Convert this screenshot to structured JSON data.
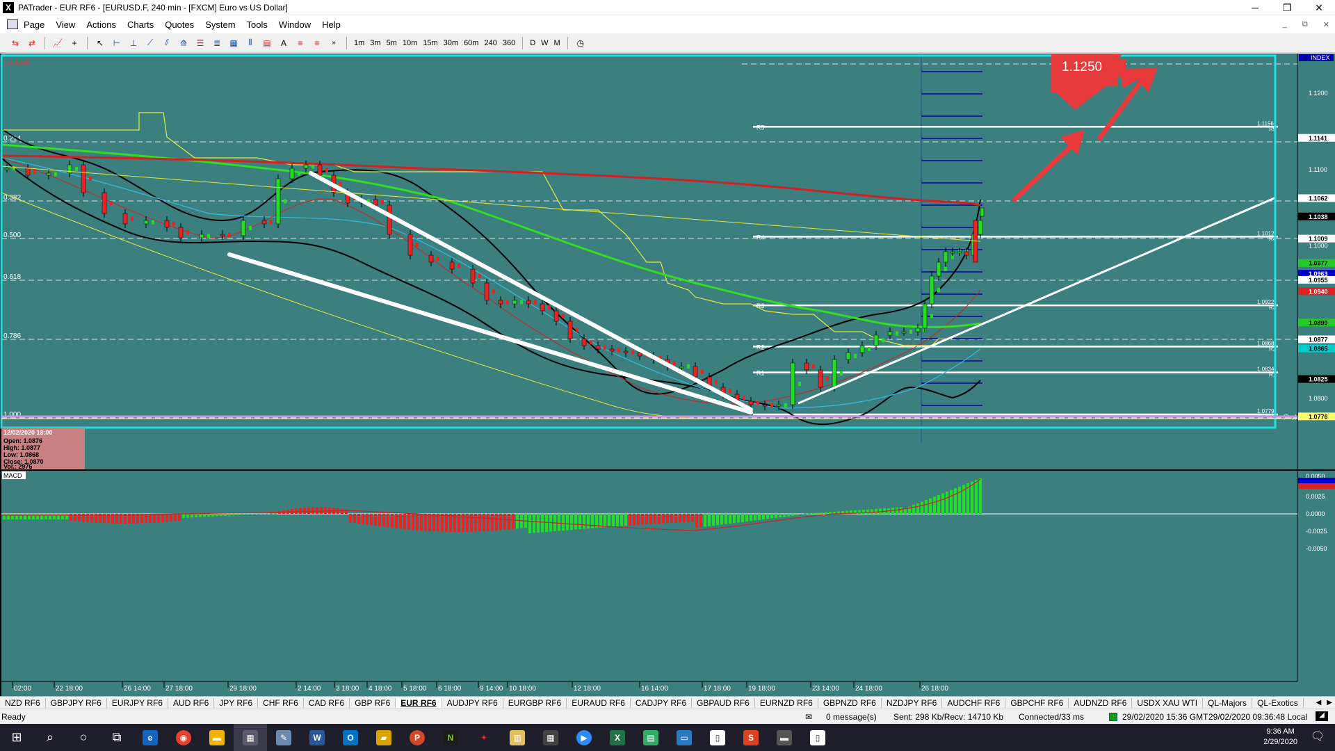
{
  "window": {
    "title": "PATrader - EUR RF6 - [EURUSD.F, 240 min - [FXCM] Euro vs US Dollar]",
    "app_icon_letter": "X",
    "minimize": "─",
    "restore": "❐",
    "close": "✕"
  },
  "menubar": {
    "items": [
      "Page",
      "View",
      "Actions",
      "Charts",
      "Quotes",
      "System",
      "Tools",
      "Window",
      "Help"
    ],
    "mdi_minimize": "_",
    "mdi_restore": "⧉",
    "mdi_close": "✕"
  },
  "toolbar": {
    "timeframes": [
      "1m",
      "3m",
      "5m",
      "10m",
      "15m",
      "30m",
      "60m",
      "240",
      "360",
      "D",
      "W",
      "M"
    ],
    "overflow": "»"
  },
  "chart": {
    "locked_label": "Locked",
    "index_label": "INDEX",
    "target_label": "1.1250",
    "fib_levels": [
      "0.214",
      "0.382",
      "0.500",
      "0.618",
      "0.786",
      "1.000"
    ],
    "pivot_labels": [
      "R5",
      "R4",
      "R3",
      "R2",
      "R1"
    ],
    "right_pivot_values": [
      "1.1156",
      "1.1012",
      "1.0922",
      "1.0868",
      "1.0834",
      "1.0779"
    ],
    "right_pivot_names": [
      "R5",
      "R4",
      "R3",
      "R2",
      "R1",
      "Base (Day)"
    ],
    "price_axis": [
      "1.1200",
      "1.1141",
      "1.1100",
      "1.1062",
      "1.1038",
      "1.1009",
      "1.1000",
      "1.0977",
      "1.0963",
      "1.0955",
      "1.0940",
      "1.0899",
      "1.0877",
      "1.0865",
      "1.0825",
      "1.0800",
      "1.0776"
    ],
    "price_highlights": {
      "1.1141": "#ffffff",
      "1.1062": "#ffffff",
      "1.1038": "#000000",
      "1.1009": "#ffffff",
      "1.0977": "#22cc22",
      "1.0963": "#0000cc",
      "1.0955": "#ffffff",
      "1.0940": "#dd2222",
      "1.0899": "#22cc22",
      "1.0877": "#ffffff",
      "1.0865": "#00cccc",
      "1.0825": "#000000",
      "1.0776": "#ffff66"
    },
    "ohlc": {
      "date": "12/02/2020 18:00",
      "open": "Open: 1.0876",
      "high": "High: 1.0877",
      "low": "Low: 1.0868",
      "close": "Close: 1.0870",
      "vol": "Vol.: 2976"
    },
    "macd_label": "MACD",
    "macd_axis": [
      "0.0050",
      "0.0025",
      "0.0000",
      "-0.0025",
      "-0.0050"
    ],
    "time_axis": [
      "02:00",
      "22 18:00",
      "26 14:00",
      "27 18:00",
      "29 18:00",
      "2 14:00",
      "3 18:00",
      "4 18:00",
      "5 18:00",
      "6 18:00",
      "9 14:00",
      "10 18:00",
      "12 18:00",
      "16 14:00",
      "17 18:00",
      "19 18:00",
      "23 14:00",
      "24 18:00",
      "26 18:00"
    ],
    "colors": {
      "background": "#3b7f7f",
      "ma_red": "#d42020",
      "ma_green": "#33dd22",
      "bollinger": "#000000",
      "frame": "#22e0e0",
      "trendline": "#ffffff",
      "arrow": "#e83a3a"
    }
  },
  "symbol_tabs": {
    "items": [
      "NZD RF6",
      "GBPJPY RF6",
      "EURJPY RF6",
      "AUD RF6",
      "JPY RF6",
      "CHF RF6",
      "CAD RF6",
      "GBP RF6",
      "EUR RF6",
      "AUDJPY RF6",
      "EURGBP RF6",
      "EURAUD RF6",
      "CADJPY RF6",
      "GBPAUD RF6",
      "EURNZD RF6",
      "GBPNZD RF6",
      "NZDJPY RF6",
      "AUDCHF RF6",
      "GBPCHF RF6",
      "AUDNZD RF6",
      "USDX XAU WTI",
      "QL-Majors",
      "QL-Exotics"
    ],
    "active": "EUR RF6",
    "prev": "◀",
    "next": "▶"
  },
  "status": {
    "ready": "Ready",
    "messages": "0 message(s)",
    "traffic": "Sent: 298 Kb/Recv: 14710 Kb",
    "connection": "Connected/33 ms",
    "gmt_time": "29/02/2020 15:36 GMT",
    "local_time": "29/02/2020 09:36:48 Local"
  },
  "taskbar": {
    "time": "9:36 AM",
    "date": "2/29/2020"
  }
}
